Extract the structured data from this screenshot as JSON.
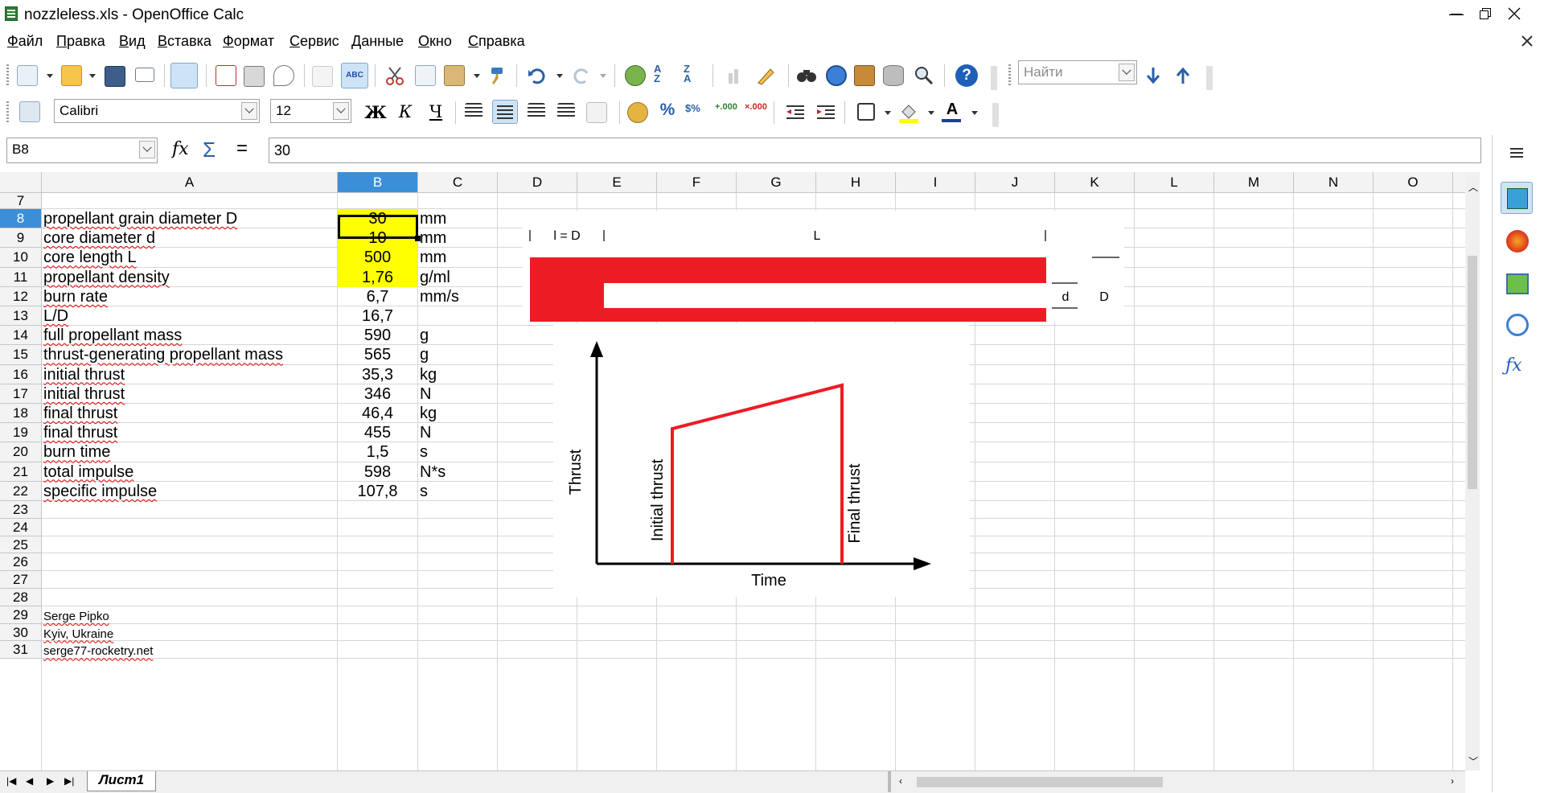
{
  "window": {
    "title": "nozzleless.xls - OpenOffice Calc"
  },
  "menu": [
    "Файл",
    "Правка",
    "Вид",
    "Вставка",
    "Формат",
    "Сервис",
    "Данные",
    "Окно",
    "Справка"
  ],
  "toolbar": {
    "search_placeholder": "Найти"
  },
  "format_bar": {
    "font_name": "Calibri",
    "font_size": "12",
    "bold": "Ж",
    "italic": "К",
    "underline": "Ч"
  },
  "formula_bar": {
    "name_box": "B8",
    "func_label": "fx",
    "sum_label": "Σ",
    "equals_label": "=",
    "content": "30"
  },
  "sheet": {
    "columns": [
      "A",
      "B",
      "C",
      "D",
      "E",
      "F",
      "G",
      "H",
      "I",
      "J",
      "K",
      "L",
      "M",
      "N",
      "O"
    ],
    "selected_column": "B",
    "selected_row": "8",
    "rows": [
      {
        "num": "7",
        "a": "",
        "b": "",
        "c": ""
      },
      {
        "num": "8",
        "a": "propellant grain diameter  D",
        "b": "30",
        "c": "mm"
      },
      {
        "num": "9",
        "a": "core diameter  d",
        "b": "10",
        "c": "mm"
      },
      {
        "num": "10",
        "a": "core length  L",
        "b": "500",
        "c": "mm"
      },
      {
        "num": "11",
        "a": "propellant density",
        "b": "1,76",
        "c": "g/ml"
      },
      {
        "num": "12",
        "a": "burn rate",
        "b": "6,7",
        "c": "mm/s"
      },
      {
        "num": "13",
        "a": "L/D",
        "b": "16,7",
        "c": ""
      },
      {
        "num": "14",
        "a": "full propellant mass",
        "b": "590",
        "c": "g"
      },
      {
        "num": "15",
        "a": "thrust-generating propellant mass",
        "b": "565",
        "c": "g"
      },
      {
        "num": "16",
        "a": "initial thrust",
        "b": "35,3",
        "c": "kg"
      },
      {
        "num": "17",
        "a": "initial thrust",
        "b": "346",
        "c": "N"
      },
      {
        "num": "18",
        "a": "final thrust",
        "b": "46,4",
        "c": "kg"
      },
      {
        "num": "19",
        "a": "final thrust",
        "b": "455",
        "c": "N"
      },
      {
        "num": "20",
        "a": "burn time",
        "b": "1,5",
        "c": "s"
      },
      {
        "num": "21",
        "a": "total impulse",
        "b": "598",
        "c": "N*s"
      },
      {
        "num": "22",
        "a": "specific impulse",
        "b": "107,8",
        "c": "s"
      },
      {
        "num": "23",
        "a": "",
        "b": "",
        "c": ""
      },
      {
        "num": "24",
        "a": "",
        "b": "",
        "c": ""
      },
      {
        "num": "25",
        "a": "",
        "b": "",
        "c": ""
      },
      {
        "num": "26",
        "a": "",
        "b": "",
        "c": ""
      },
      {
        "num": "27",
        "a": "",
        "b": "",
        "c": ""
      },
      {
        "num": "28",
        "a": "",
        "b": "",
        "c": ""
      },
      {
        "num": "29",
        "a": "Serge Pipko",
        "b": "",
        "c": ""
      },
      {
        "num": "30",
        "a": "Kyiv, Ukraine",
        "b": "",
        "c": ""
      },
      {
        "num": "31",
        "a": "serge77-rocketry.net",
        "b": "",
        "c": ""
      }
    ],
    "highlight_color": "#ffff00"
  },
  "grain_diagram": {
    "l_eq_d_label": "l = D",
    "length_label": "L",
    "core_label": "d",
    "diameter_label": "D",
    "fill_color": "#ed1c24"
  },
  "thrust_diagram": {
    "y_label": "Thrust",
    "x_label": "Time",
    "initial_label": "Initial thrust",
    "final_label": "Final thrust",
    "curve_color": "#ed1c24"
  },
  "tabs": {
    "sheet_tab": "Лист1"
  }
}
